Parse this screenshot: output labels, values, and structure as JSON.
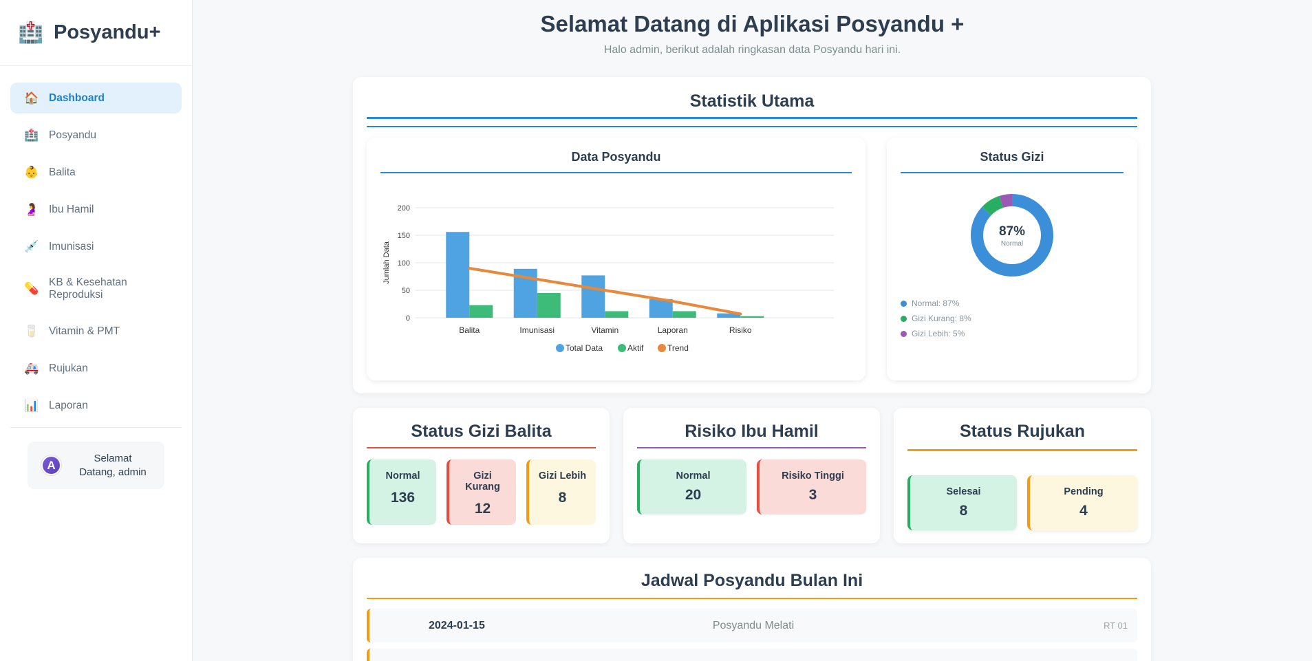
{
  "sidebar": {
    "brand": {
      "icon": "🏥",
      "name": "Posyandu+"
    },
    "items": [
      {
        "label": "Dashboard",
        "icon": "🏠",
        "icon_name": "house-icon",
        "active": true
      },
      {
        "label": "Posyandu",
        "icon": "🏥",
        "icon_name": "hospital-icon"
      },
      {
        "label": "Balita",
        "icon": "👶",
        "icon_name": "baby-icon"
      },
      {
        "label": "Ibu Hamil",
        "icon": "🤰",
        "icon_name": "pregnant-woman-icon"
      },
      {
        "label": "Imunisasi",
        "icon": "💉",
        "icon_name": "syringe-icon"
      },
      {
        "label": "KB & Kesehatan Reproduksi",
        "icon": "💊",
        "icon_name": "pill-icon"
      },
      {
        "label": "Vitamin & PMT",
        "icon": "🥛",
        "icon_name": "milk-glass-icon"
      },
      {
        "label": "Rujukan",
        "icon": "🚑",
        "icon_name": "ambulance-icon"
      },
      {
        "label": "Laporan",
        "icon": "📊",
        "icon_name": "bar-chart-icon"
      }
    ],
    "user": {
      "initial": "A",
      "greeting": "Selamat Datang, admin"
    }
  },
  "header": {
    "title": "Selamat Datang di Aplikasi Posyandu +",
    "subtitle": "Halo admin, berikut adalah ringkasan data Posyandu hari ini."
  },
  "stats": {
    "title": "Statistik Utama",
    "bar_chart_title": "Data Posyandu",
    "donut_title": "Status Gizi"
  },
  "chart_data": [
    {
      "type": "bar",
      "title": "Data Posyandu",
      "xlabel": "",
      "ylabel": "Jumlah Data",
      "ylim": [
        0,
        200
      ],
      "yticks": [
        "0",
        "50",
        "100",
        "150",
        "200"
      ],
      "grid": true,
      "legend_position": "bottom",
      "categories": [
        "Balita",
        "Imunisasi",
        "Vitamin",
        "Laporan",
        "Risiko"
      ],
      "series": [
        {
          "name": "Total Data",
          "type": "bar",
          "color": "#4fa3e0",
          "values": [
            156,
            89,
            77,
            34,
            8
          ]
        },
        {
          "name": "Aktif",
          "type": "bar",
          "color": "#3dbb78",
          "values": [
            23,
            45,
            12,
            12,
            3
          ]
        },
        {
          "name": "Trend",
          "type": "line",
          "color": "#e8883a",
          "values": [
            90,
            70,
            50,
            30,
            7
          ]
        }
      ]
    },
    {
      "type": "pie",
      "title": "Status Gizi",
      "center_value": "87%",
      "center_label": "Normal",
      "slices": [
        {
          "label": "Normal: 87%",
          "value": 87,
          "color": "#3a8fd8"
        },
        {
          "label": "Gizi Kurang: 8%",
          "value": 8,
          "color": "#27ae60"
        },
        {
          "label": "Gizi Lebih: 5%",
          "value": 5,
          "color": "#9b59b6"
        }
      ]
    }
  ],
  "gizi_balita": {
    "title": "Status Gizi Balita",
    "tiles": [
      {
        "label": "Normal",
        "value": "136"
      },
      {
        "label": "Gizi Kurang",
        "value": "12"
      },
      {
        "label": "Gizi Lebih",
        "value": "8"
      }
    ]
  },
  "ibu_hamil": {
    "title": "Risiko Ibu Hamil",
    "tiles": [
      {
        "label": "Normal",
        "value": "20"
      },
      {
        "label": "Risiko Tinggi",
        "value": "3"
      }
    ]
  },
  "rujukan": {
    "title": "Status Rujukan",
    "tiles": [
      {
        "label": "Selesai",
        "value": "8"
      },
      {
        "label": "Pending",
        "value": "4"
      }
    ]
  },
  "schedule": {
    "title": "Jadwal Posyandu Bulan Ini",
    "rows": [
      {
        "date": "2024-01-15",
        "name": "Posyandu Melati",
        "location": "RT 01"
      }
    ]
  },
  "colors": {
    "accent_blue": "#2a88d8",
    "red": "#e74c3c",
    "purple": "#9b59b6",
    "orange": "#f39c12"
  }
}
